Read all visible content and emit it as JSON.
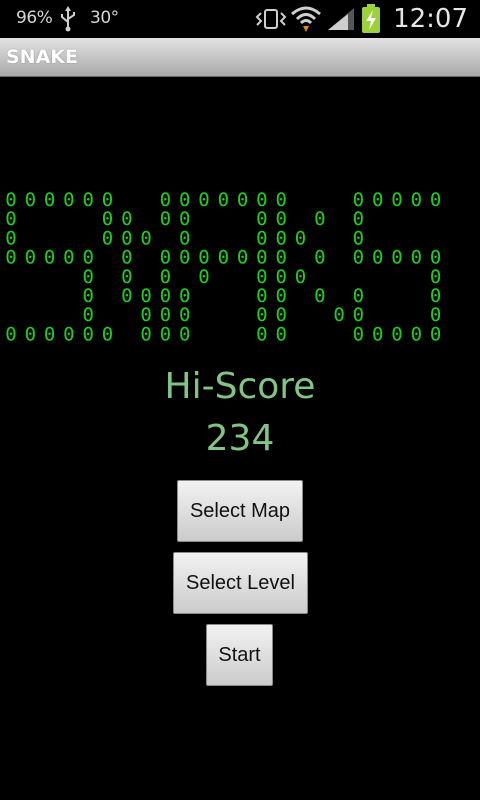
{
  "status_bar": {
    "battery_text": "96%",
    "temperature": "30°",
    "time": "12:07",
    "icons": [
      "usb-icon",
      "vibrate-icon",
      "wifi-icon",
      "signal-icon",
      "battery-charging-icon"
    ]
  },
  "app": {
    "title": "SNAKE"
  },
  "logo": {
    "text": "SNAKE",
    "glyph": "0",
    "color": "#19d319"
  },
  "hiscore": {
    "label": "Hi-Score",
    "value": "234"
  },
  "buttons": {
    "select_map": "Select Map",
    "select_level": "Select Level",
    "start": "Start"
  }
}
